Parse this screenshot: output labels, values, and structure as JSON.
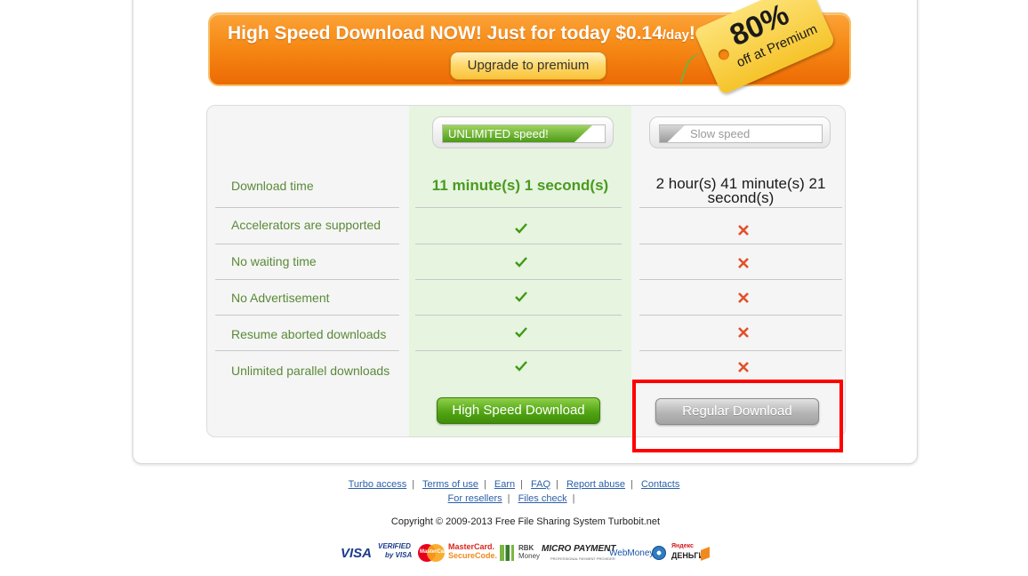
{
  "banner": {
    "headline_main": "High Speed Download NOW! Just for today $0.14",
    "headline_unit": "/day",
    "headline_end": "!",
    "upgrade_label": "Upgrade to premium",
    "tag_percent": "80%",
    "tag_sub": "off at Premium"
  },
  "compare": {
    "premium_speed_label": "UNLIMITED speed!",
    "slow_speed_label": "Slow speed",
    "features": [
      "Download time",
      "Accelerators are supported",
      "No waiting time",
      "No Advertisement",
      "Resume aborted downloads",
      "Unlimited parallel downloads"
    ],
    "premium_time": "11 minute(s) 1 second(s)",
    "slow_time": "2 hour(s) 41 minute(s) 21 second(s)",
    "high_speed_button": "High Speed Download",
    "regular_button": "Regular Download"
  },
  "footer": {
    "links_row1": [
      "Turbo access",
      "Terms of use",
      "Earn",
      "FAQ",
      "Report abuse",
      "Contacts"
    ],
    "links_row2": [
      "For resellers",
      "Files check"
    ],
    "copyright": "Copyright © 2009-2013 Free File Sharing System Turbobit.net"
  },
  "payments": {
    "visa": "VISA",
    "verified_top": "VERIFIED",
    "verified_bottom": "by VISA",
    "mastercard_badge": "MasterCard",
    "securecode_top": "MasterCard.",
    "securecode_bottom": "SecureCode.",
    "rbk_top": "RBK",
    "rbk_bottom": "Money",
    "micropayment": "MICRO PAYMENT",
    "micropayment_sub": "PROFESSIONAL PAYMENT PROVIDER",
    "webmoney": "WebMoney",
    "yandex_top": "Яндекс",
    "yandex_bottom": "ДЕНЬГИ"
  },
  "colors": {
    "accent_orange": "#f68a16",
    "premium_green": "#4b9a1f",
    "highlight_red": "#ff0000",
    "link_blue": "#2c5fa8"
  }
}
